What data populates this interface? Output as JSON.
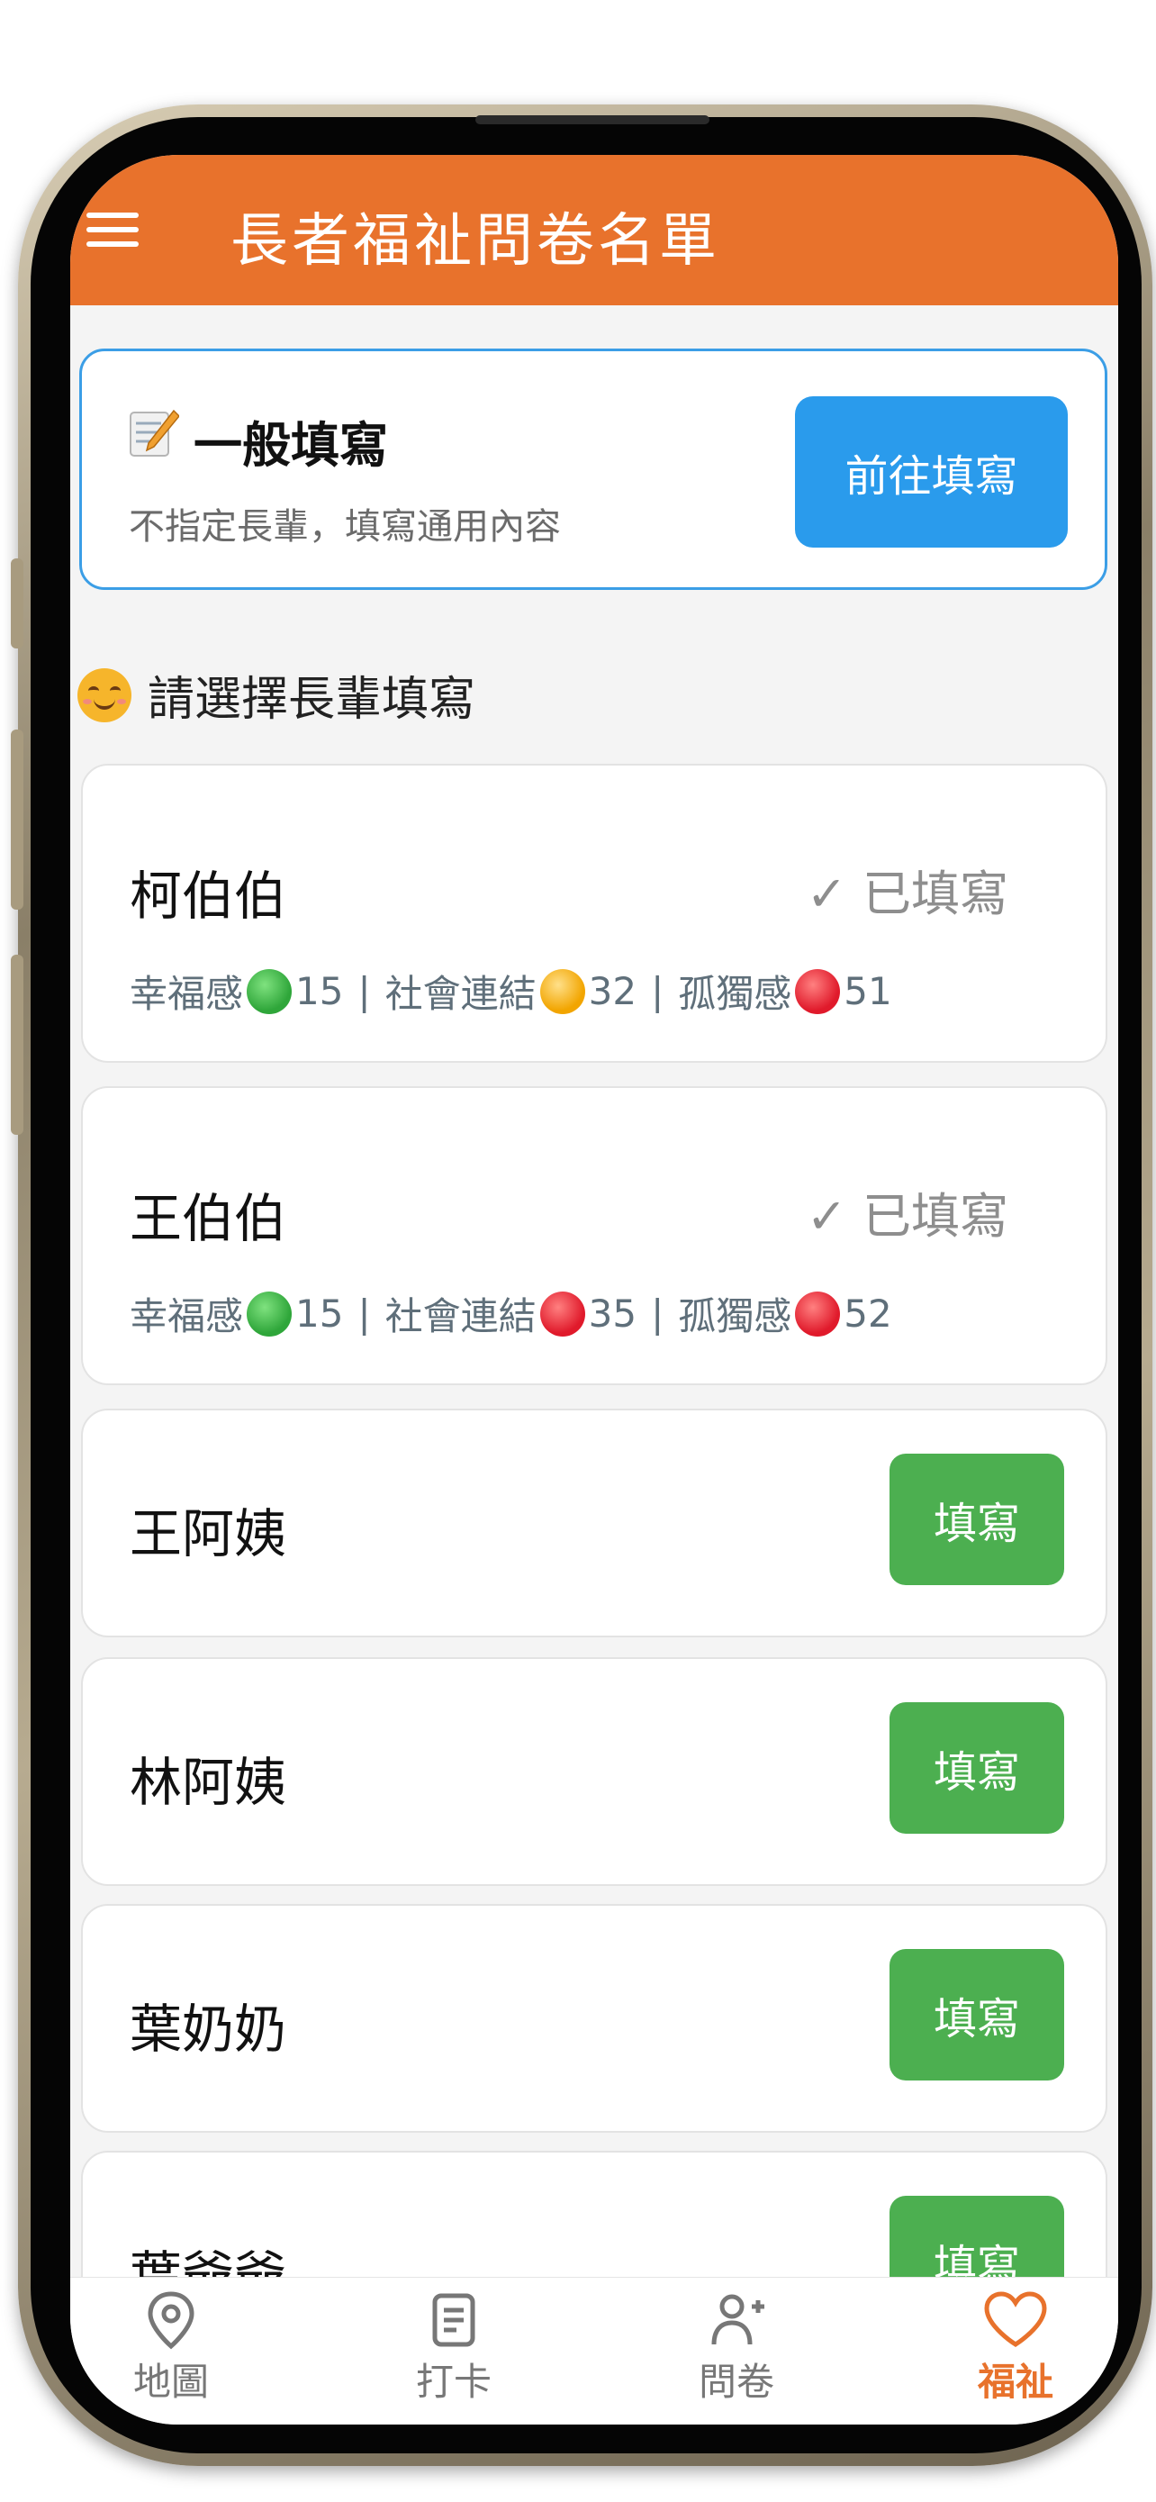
{
  "header": {
    "title": "長者福祉問卷名單"
  },
  "general": {
    "title": "一般填寫",
    "description": "不指定長輩，填寫通用內容",
    "button_label": "前往填寫"
  },
  "section": {
    "heading": "請選擇長輩填寫"
  },
  "elders": [
    {
      "name": "柯伯伯",
      "status": "✓ 已填寫",
      "scores": [
        {
          "label": "幸福感",
          "color": "#2fa63a",
          "value": "15"
        },
        {
          "label": "社會連結",
          "color": "#f2a500",
          "value": "32"
        },
        {
          "label": "孤獨感",
          "color": "#e01a2b",
          "value": "51"
        }
      ]
    },
    {
      "name": "王伯伯",
      "status": "✓ 已填寫",
      "scores": [
        {
          "label": "幸福感",
          "color": "#2fa63a",
          "value": "15"
        },
        {
          "label": "社會連結",
          "color": "#e01a2b",
          "value": "35"
        },
        {
          "label": "孤獨感",
          "color": "#e01a2b",
          "value": "52"
        }
      ]
    },
    {
      "name": "王阿姨",
      "button_label": "填寫"
    },
    {
      "name": "林阿姨",
      "button_label": "填寫"
    },
    {
      "name": "葉奶奶",
      "button_label": "填寫"
    },
    {
      "name": "葉爺爺",
      "button_label": "填寫"
    }
  ],
  "separator": "|",
  "tabs": [
    {
      "label": "地圖",
      "icon": "map-pin-icon"
    },
    {
      "label": "打卡",
      "icon": "document-icon"
    },
    {
      "label": "問卷",
      "icon": "add-user-icon"
    },
    {
      "label": "福祉",
      "icon": "heart-icon",
      "active": true
    }
  ],
  "colors": {
    "header": "#e8722c",
    "primary_button": "#2a9bec",
    "fill_button": "#4caf50",
    "active_tab": "#e8722c"
  }
}
